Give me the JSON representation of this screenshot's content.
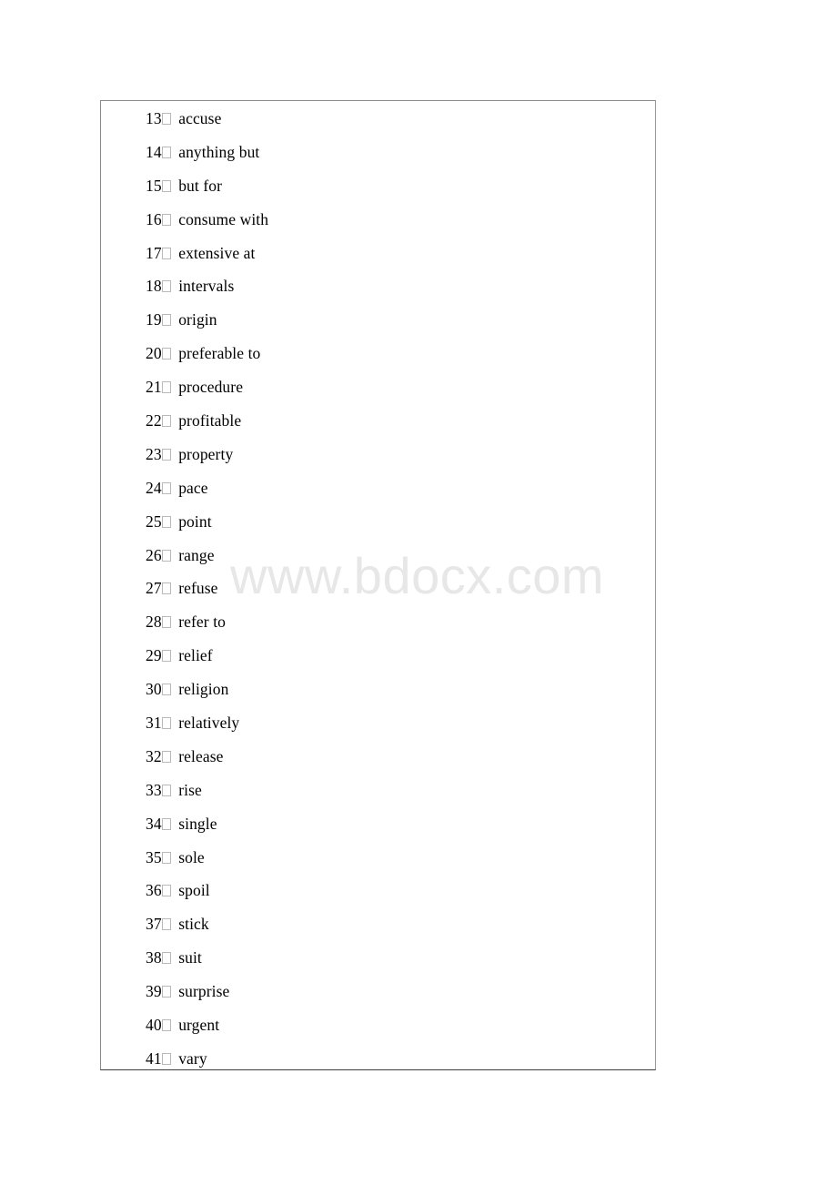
{
  "document": {
    "background_color": "#ffffff",
    "frame_border_color": "#8a8a8a"
  },
  "watermark": {
    "text": "www.bdocx.com",
    "color": "#e7e7e7"
  },
  "list": {
    "bullet_glyph": "tofu-box",
    "items": [
      {
        "number": "13",
        "word": "accuse"
      },
      {
        "number": "14",
        "word": "anything but"
      },
      {
        "number": "15",
        "word": "but for"
      },
      {
        "number": "16",
        "word": "consume with"
      },
      {
        "number": "17",
        "word": "extensive at"
      },
      {
        "number": "18",
        "word": "intervals"
      },
      {
        "number": "19",
        "word": "origin"
      },
      {
        "number": "20",
        "word": "preferable to"
      },
      {
        "number": "21",
        "word": "procedure"
      },
      {
        "number": "22",
        "word": "profitable"
      },
      {
        "number": "23",
        "word": "property"
      },
      {
        "number": "24",
        "word": "pace"
      },
      {
        "number": "25",
        "word": "point"
      },
      {
        "number": "26",
        "word": "range"
      },
      {
        "number": "27",
        "word": "refuse"
      },
      {
        "number": "28",
        "word": "refer to"
      },
      {
        "number": "29",
        "word": "relief"
      },
      {
        "number": "30",
        "word": "religion"
      },
      {
        "number": "31",
        "word": "relatively"
      },
      {
        "number": "32",
        "word": "release"
      },
      {
        "number": "33",
        "word": "rise"
      },
      {
        "number": "34",
        "word": "single"
      },
      {
        "number": "35",
        "word": "sole"
      },
      {
        "number": "36",
        "word": "spoil"
      },
      {
        "number": "37",
        "word": "stick"
      },
      {
        "number": "38",
        "word": "suit"
      },
      {
        "number": "39",
        "word": "surprise"
      },
      {
        "number": "40",
        "word": "urgent"
      },
      {
        "number": "41",
        "word": "vary"
      }
    ]
  }
}
